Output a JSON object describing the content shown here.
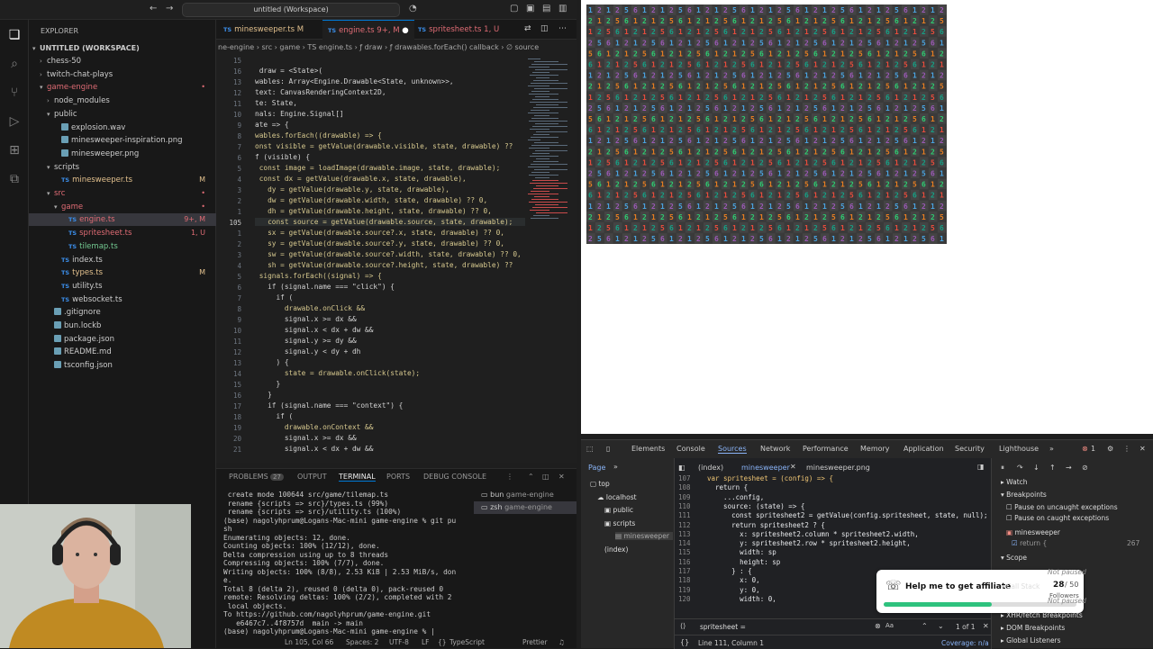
{
  "titlebar": {
    "search": "untitled (Workspace)"
  },
  "sidebar": {
    "header": "EXPLORER",
    "workspace": "UNTITLED (WORKSPACE)",
    "items": [
      {
        "label": "chess-50",
        "depth": 1,
        "kind": "folder",
        "open": false
      },
      {
        "label": "twitch-chat-plays",
        "depth": 1,
        "kind": "folder",
        "open": false
      },
      {
        "label": "game-engine",
        "depth": 1,
        "kind": "folder",
        "open": true,
        "color": "#e06c75"
      },
      {
        "label": "node_modules",
        "depth": 2,
        "kind": "folder",
        "open": false
      },
      {
        "label": "public",
        "depth": 2,
        "kind": "folder",
        "open": true
      },
      {
        "label": "explosion.wav",
        "depth": 3,
        "kind": "file"
      },
      {
        "label": "minesweeper-inspiration.png",
        "depth": 3,
        "kind": "file"
      },
      {
        "label": "minesweeper.png",
        "depth": 3,
        "kind": "file"
      },
      {
        "label": "scripts",
        "depth": 2,
        "kind": "folder",
        "open": true
      },
      {
        "label": "minesweeper.ts",
        "depth": 3,
        "kind": "ts",
        "badge": "M",
        "color": "#e2c08d"
      },
      {
        "label": "src",
        "depth": 2,
        "kind": "folder",
        "open": true,
        "color": "#e06c75"
      },
      {
        "label": "game",
        "depth": 3,
        "kind": "folder",
        "open": true,
        "color": "#e06c75"
      },
      {
        "label": "engine.ts",
        "depth": 4,
        "kind": "ts",
        "badge": "9+, M",
        "color": "#e06c75",
        "selected": true
      },
      {
        "label": "spritesheet.ts",
        "depth": 4,
        "kind": "ts",
        "badge": "1, U",
        "color": "#e06c75"
      },
      {
        "label": "tilemap.ts",
        "depth": 4,
        "kind": "ts",
        "color": "#73c991"
      },
      {
        "label": "index.ts",
        "depth": 3,
        "kind": "ts"
      },
      {
        "label": "types.ts",
        "depth": 3,
        "kind": "ts",
        "badge": "M",
        "color": "#e2c08d"
      },
      {
        "label": "utility.ts",
        "depth": 3,
        "kind": "ts"
      },
      {
        "label": "websocket.ts",
        "depth": 3,
        "kind": "ts"
      },
      {
        "label": ".gitignore",
        "depth": 2,
        "kind": "file"
      },
      {
        "label": "bun.lockb",
        "depth": 2,
        "kind": "file"
      },
      {
        "label": "package.json",
        "depth": 2,
        "kind": "file"
      },
      {
        "label": "README.md",
        "depth": 2,
        "kind": "file"
      },
      {
        "label": "tsconfig.json",
        "depth": 2,
        "kind": "file"
      }
    ]
  },
  "editor": {
    "tabs": [
      {
        "label": "minesweeper.ts",
        "suffix": "M",
        "active": false
      },
      {
        "label": "engine.ts",
        "suffix": "9+, M",
        "active": true
      },
      {
        "label": "spritesheet.ts",
        "suffix": "1, U",
        "active": false
      }
    ],
    "breadcrumb": "ne-engine › src › game › TS engine.ts › ƒ draw › ƒ drawables.forEach() callback › ∅ source",
    "lines": [
      {
        "n": "15",
        "t": ""
      },
      {
        "n": "16",
        "t": " draw = <State>("
      },
      {
        "n": "13",
        "t": "wables: Array<Engine.Drawable<State, unknown>>,"
      },
      {
        "n": "12",
        "t": "text: CanvasRenderingContext2D,"
      },
      {
        "n": "11",
        "t": "te: State,"
      },
      {
        "n": "10",
        "t": "nals: Engine.Signal[]"
      },
      {
        "n": "9",
        "t": "ate => {"
      },
      {
        "n": "8",
        "t": "wables.forEach((drawable) => {"
      },
      {
        "n": "7",
        "t": "onst visible = getValue(drawable.visible, state, drawable) ??"
      },
      {
        "n": "6",
        "t": "f (visible) {"
      },
      {
        "n": "5",
        "t": " const image = loadImage(drawable.image, state, drawable);"
      },
      {
        "n": "4",
        "t": " const dx = getValue(drawable.x, state, drawable),"
      },
      {
        "n": "3",
        "t": "   dy = getValue(drawable.y, state, drawable),"
      },
      {
        "n": "2",
        "t": "   dw = getValue(drawable.width, state, drawable) ?? 0,"
      },
      {
        "n": "1",
        "t": "   dh = getValue(drawable.height, state, drawable) ?? 0,"
      },
      {
        "n": "105",
        "t": "   const source = getValue(drawable.source, state, drawable);"
      },
      {
        "n": "1",
        "t": "   sx = getValue(drawable.source?.x, state, drawable) ?? 0,"
      },
      {
        "n": "2",
        "t": "   sy = getValue(drawable.source?.y, state, drawable) ?? 0,"
      },
      {
        "n": "3",
        "t": "   sw = getValue(drawable.source?.width, state, drawable) ?? 0,"
      },
      {
        "n": "4",
        "t": "   sh = getValue(drawable.source?.height, state, drawable) ??"
      },
      {
        "n": "5",
        "t": " signals.forEach((signal) => {"
      },
      {
        "n": "6",
        "t": "   if (signal.name === \"click\") {"
      },
      {
        "n": "7",
        "t": "     if ("
      },
      {
        "n": "8",
        "t": "       drawable.onClick &&"
      },
      {
        "n": "9",
        "t": "       signal.x >= dx &&"
      },
      {
        "n": "10",
        "t": "       signal.x < dx + dw &&"
      },
      {
        "n": "11",
        "t": "       signal.y >= dy &&"
      },
      {
        "n": "12",
        "t": "       signal.y < dy + dh"
      },
      {
        "n": "13",
        "t": "     ) {"
      },
      {
        "n": "14",
        "t": "       state = drawable.onClick(state);"
      },
      {
        "n": "15",
        "t": "     }"
      },
      {
        "n": "16",
        "t": "   }"
      },
      {
        "n": "17",
        "t": "   if (signal.name === \"context\") {"
      },
      {
        "n": "18",
        "t": "     if ("
      },
      {
        "n": "19",
        "t": "       drawable.onContext &&"
      },
      {
        "n": "20",
        "t": "       signal.x >= dx &&"
      },
      {
        "n": "21",
        "t": "       signal.x < dx + dw &&"
      }
    ]
  },
  "panel": {
    "tabs": [
      "PROBLEMS",
      "27",
      "OUTPUT",
      "TERMINAL",
      "PORTS",
      "DEBUG CONSOLE"
    ],
    "terminal": [
      " create mode 100644 src/game/tilemap.ts",
      " rename {scripts => src}/types.ts (99%)",
      " rename {scripts => src}/utility.ts (100%)",
      "(base) nagolyhprum@Logans-Mac-mini game-engine % git pu",
      "sh",
      "Enumerating objects: 12, done.",
      "Counting objects: 100% (12/12), done.",
      "Delta compression using up to 8 threads",
      "Compressing objects: 100% (7/7), done.",
      "Writing objects: 100% (8/8), 2.53 KiB | 2.53 MiB/s, don",
      "e.",
      "Total 8 (delta 2), reused 0 (delta 0), pack-reused 0",
      "remote: Resolving deltas: 100% (2/2), completed with 2",
      " local objects.",
      "To https://github.com/nagolyhprum/game-engine.git",
      "   e6467c7..4f8757d  main -> main",
      "(base) nagolyhprum@Logans-Mac-mini game-engine % |"
    ],
    "terminals": [
      {
        "name": "bun",
        "cwd": "game-engine"
      },
      {
        "name": "zsh",
        "cwd": "game-engine"
      }
    ]
  },
  "status": {
    "pos": "Ln 105, Col 66",
    "spaces": "Spaces: 2",
    "enc": "UTF-8",
    "eol": "LF",
    "lang": "TypeScript",
    "fmt": "Prettier"
  },
  "devtools": {
    "tabs": [
      "Elements",
      "Console",
      "Sources",
      "Network",
      "Performance",
      "Memory",
      "Application",
      "Security",
      "Lighthouse"
    ],
    "errors": "1",
    "page_tab": "Page",
    "file_tabs": [
      "(index)",
      "minesweeper",
      "minesweeper.png"
    ],
    "tree": [
      "top",
      "localhost",
      "public",
      "scripts",
      "minesweeper",
      "(index)"
    ],
    "source": [
      {
        "n": "107",
        "t": "var spritesheet = (config) => {"
      },
      {
        "n": "108",
        "t": "  return {"
      },
      {
        "n": "109",
        "t": "    ...config,"
      },
      {
        "n": "110",
        "t": "    source: (state) => {"
      },
      {
        "n": "111",
        "t": "      const spritesheet2 = getValue(config.spritesheet, state, null);"
      },
      {
        "n": "112",
        "t": "      return spritesheet2 ? {"
      },
      {
        "n": "113",
        "t": "        x: spritesheet2.column * spritesheet2.width,"
      },
      {
        "n": "114",
        "t": "        y: spritesheet2.row * spritesheet2.height,"
      },
      {
        "n": "115",
        "t": "        width: sp"
      },
      {
        "n": "116",
        "t": "        height: sp"
      },
      {
        "n": "117",
        "t": "      } : {"
      },
      {
        "n": "118",
        "t": "        x: 0,"
      },
      {
        "n": "119",
        "t": "        y: 0,"
      },
      {
        "n": "120",
        "t": "        width: 0,"
      }
    ],
    "search": "spritesheet =",
    "search_result": "1 of 1",
    "cursor": "Line 111, Column 1",
    "coverage": "Coverage: n/a",
    "right": {
      "watch": "Watch",
      "breakpoints": "Breakpoints",
      "pause_uncaught": "Pause on uncaught exceptions",
      "pause_caught": "Pause on caught exceptions",
      "bp_file": "minesweeper",
      "bp_line": "return {",
      "bp_num": "267",
      "scope": "Scope",
      "not_paused": "Not paused",
      "call_stack": "Call Stack",
      "not_paused2": "Not paused",
      "xhr": "XHR/fetch Breakpoints",
      "dom": "DOM Breakpoints",
      "global": "Global Listeners"
    }
  },
  "toast": {
    "title": "Help me to get affiliate",
    "count": "28",
    "total": "/ 50",
    "followers": "Followers",
    "progress": 0.56
  }
}
